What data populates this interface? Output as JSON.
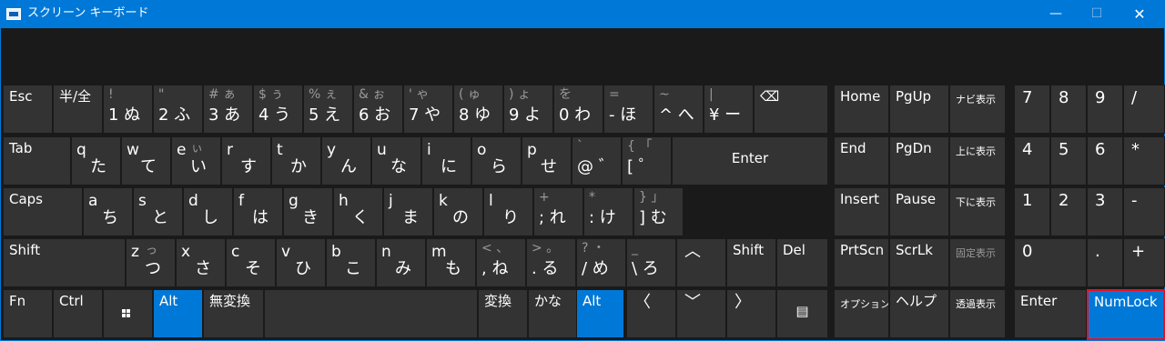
{
  "window": {
    "title": "スクリーン キーボード"
  },
  "titlebar_buttons": {
    "minimize": "—",
    "maximize": "☐",
    "close": "✕"
  },
  "row1": [
    {
      "name": "key-esc",
      "label": "Esc"
    },
    {
      "name": "key-hankaku",
      "label": "半/全"
    },
    {
      "name": "key-1",
      "shift": "!",
      "main": "1 ぬ"
    },
    {
      "name": "key-2",
      "shift": "\"",
      "main": "2 ふ"
    },
    {
      "name": "key-3",
      "shift": "# ぁ",
      "main": "3 あ"
    },
    {
      "name": "key-4",
      "shift": "$ ぅ",
      "main": "4 う"
    },
    {
      "name": "key-5",
      "shift": "% ぇ",
      "main": "5 え"
    },
    {
      "name": "key-6",
      "shift": "& ぉ",
      "main": "6 お"
    },
    {
      "name": "key-7",
      "shift": "' ゃ",
      "main": "7 や"
    },
    {
      "name": "key-8",
      "shift": "( ゅ",
      "main": "8 ゆ"
    },
    {
      "name": "key-9",
      "shift": ") ょ",
      "main": "9 よ"
    },
    {
      "name": "key-0",
      "shift": "を",
      "main": "0 わ"
    },
    {
      "name": "key-minus",
      "shift": "=",
      "main": "- ほ"
    },
    {
      "name": "key-caret",
      "shift": "~",
      "main": "^ へ"
    },
    {
      "name": "key-yen",
      "shift": "|",
      "main": "¥ ー"
    },
    {
      "name": "key-backspace",
      "label": "⌫"
    }
  ],
  "row2": [
    {
      "name": "key-tab",
      "label": "Tab"
    },
    {
      "name": "key-q",
      "letter": "q",
      "kana": "た"
    },
    {
      "name": "key-w",
      "letter": "w",
      "kana": "て"
    },
    {
      "name": "key-e",
      "letter": "e",
      "kana": "い",
      "kanasm": "ぃ"
    },
    {
      "name": "key-r",
      "letter": "r",
      "kana": "す"
    },
    {
      "name": "key-t",
      "letter": "t",
      "kana": "か"
    },
    {
      "name": "key-y",
      "letter": "y",
      "kana": "ん"
    },
    {
      "name": "key-u",
      "letter": "u",
      "kana": "な"
    },
    {
      "name": "key-i",
      "letter": "i",
      "kana": "に"
    },
    {
      "name": "key-o",
      "letter": "o",
      "kana": "ら"
    },
    {
      "name": "key-p",
      "letter": "p",
      "kana": "せ"
    },
    {
      "name": "key-at",
      "shift": "`",
      "main": "@ ゛"
    },
    {
      "name": "key-bracket-open",
      "shift": "{ 「",
      "main": "[ ゜"
    },
    {
      "name": "key-enter",
      "label": "Enter"
    }
  ],
  "row3": [
    {
      "name": "key-caps",
      "label": "Caps"
    },
    {
      "name": "key-a",
      "letter": "a",
      "kana": "ち"
    },
    {
      "name": "key-s",
      "letter": "s",
      "kana": "と"
    },
    {
      "name": "key-d",
      "letter": "d",
      "kana": "し"
    },
    {
      "name": "key-f",
      "letter": "f",
      "kana": "は"
    },
    {
      "name": "key-g",
      "letter": "g",
      "kana": "き"
    },
    {
      "name": "key-h",
      "letter": "h",
      "kana": "く"
    },
    {
      "name": "key-j",
      "letter": "j",
      "kana": "ま"
    },
    {
      "name": "key-k",
      "letter": "k",
      "kana": "の"
    },
    {
      "name": "key-l",
      "letter": "l",
      "kana": "り"
    },
    {
      "name": "key-semicolon",
      "shift": "+",
      "main": "; れ"
    },
    {
      "name": "key-colon",
      "shift": "*",
      "main": ": け"
    },
    {
      "name": "key-bracket-close",
      "shift": "} 」",
      "main": "] む"
    }
  ],
  "row4": [
    {
      "name": "key-shift-left",
      "label": "Shift"
    },
    {
      "name": "key-z",
      "letter": "z",
      "kana": "つ",
      "kanasm": "っ"
    },
    {
      "name": "key-x",
      "letter": "x",
      "kana": "さ"
    },
    {
      "name": "key-c",
      "letter": "c",
      "kana": "そ"
    },
    {
      "name": "key-v",
      "letter": "v",
      "kana": "ひ"
    },
    {
      "name": "key-b",
      "letter": "b",
      "kana": "こ"
    },
    {
      "name": "key-n",
      "letter": "n",
      "kana": "み"
    },
    {
      "name": "key-m",
      "letter": "m",
      "kana": "も"
    },
    {
      "name": "key-comma",
      "shift": "< 、",
      "main": ", ね"
    },
    {
      "name": "key-period",
      "shift": "> 。",
      "main": ". る"
    },
    {
      "name": "key-slash",
      "shift": "? ・",
      "main": "/ め"
    },
    {
      "name": "key-backslash",
      "shift": "_",
      "main": "\\ ろ"
    },
    {
      "name": "key-up",
      "label": "︿"
    },
    {
      "name": "key-shift-right",
      "label": "Shift"
    },
    {
      "name": "key-del",
      "label": "Del"
    }
  ],
  "row5": [
    {
      "name": "key-fn",
      "label": "Fn"
    },
    {
      "name": "key-ctrl",
      "label": "Ctrl"
    },
    {
      "name": "key-windows",
      "label": ""
    },
    {
      "name": "key-alt-left",
      "label": "Alt"
    },
    {
      "name": "key-muhenkan",
      "label": "無変換"
    },
    {
      "name": "key-space",
      "label": ""
    },
    {
      "name": "key-henkan",
      "label": "変換"
    },
    {
      "name": "key-kana",
      "label": "かな"
    },
    {
      "name": "key-alt-right",
      "label": "Alt"
    },
    {
      "name": "key-left",
      "label": "〈"
    },
    {
      "name": "key-down",
      "label": "﹀"
    },
    {
      "name": "key-right",
      "label": "〉"
    },
    {
      "name": "key-menu",
      "label": "▤"
    }
  ],
  "nav": [
    {
      "name": "key-home",
      "label": "Home"
    },
    {
      "name": "key-pgup",
      "label": "PgUp"
    },
    {
      "name": "key-nav-show",
      "label": "ナビ表示"
    },
    {
      "name": "key-end",
      "label": "End"
    },
    {
      "name": "key-pgdn",
      "label": "PgDn"
    },
    {
      "name": "key-dock-top",
      "label": "上に表示"
    },
    {
      "name": "key-insert",
      "label": "Insert"
    },
    {
      "name": "key-pause",
      "label": "Pause"
    },
    {
      "name": "key-dock-bottom",
      "label": "下に表示"
    },
    {
      "name": "key-prtscn",
      "label": "PrtScn"
    },
    {
      "name": "key-scrlk",
      "label": "ScrLk"
    },
    {
      "name": "key-fixed-show",
      "label": "固定表示"
    },
    {
      "name": "key-options",
      "label": "オプション"
    },
    {
      "name": "key-help",
      "label": "ヘルプ"
    },
    {
      "name": "key-fade",
      "label": "透過表示"
    }
  ],
  "numpad": [
    {
      "name": "key-num7",
      "label": "7"
    },
    {
      "name": "key-num8",
      "label": "8"
    },
    {
      "name": "key-num9",
      "label": "9"
    },
    {
      "name": "key-numdiv",
      "label": "/"
    },
    {
      "name": "key-num4",
      "label": "4"
    },
    {
      "name": "key-num5",
      "label": "5"
    },
    {
      "name": "key-num6",
      "label": "6"
    },
    {
      "name": "key-nummul",
      "label": "*"
    },
    {
      "name": "key-num1",
      "label": "1"
    },
    {
      "name": "key-num2",
      "label": "2"
    },
    {
      "name": "key-num3",
      "label": "3"
    },
    {
      "name": "key-numsub",
      "label": "-"
    },
    {
      "name": "key-num0",
      "label": "0"
    },
    {
      "name": "key-numdot",
      "label": "."
    },
    {
      "name": "key-numadd",
      "label": "+"
    },
    {
      "name": "key-numenter",
      "label": "Enter"
    },
    {
      "name": "key-numlock",
      "label": "NumLock"
    }
  ],
  "colors": {
    "accent": "#0078d7",
    "key": "#333333",
    "background": "#1a1a1a",
    "selected_border": "#e81123"
  }
}
